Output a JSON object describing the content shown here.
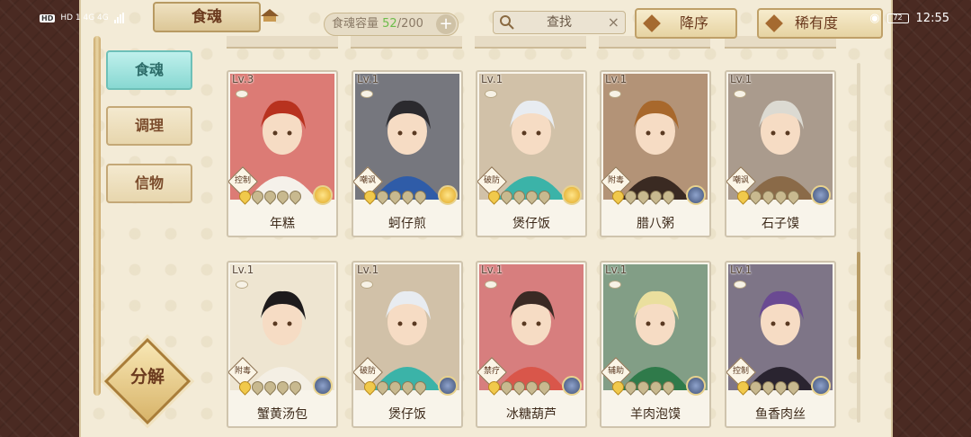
{
  "status_bar": {
    "left_text": "HD 1 4G 4G",
    "time": "12:55",
    "battery": "72"
  },
  "topbar": {
    "title": "食魂",
    "capacity": {
      "label": "食魂容量",
      "current": "52",
      "max": "/200"
    },
    "search": {
      "placeholder": "查找",
      "clear": "×"
    },
    "sort_order": "降序",
    "sort_by": "稀有度"
  },
  "sidebar": {
    "items": [
      {
        "label": "食魂",
        "active": true
      },
      {
        "label": "调理",
        "active": false
      },
      {
        "label": "信物",
        "active": false
      }
    ],
    "decompose": "分解"
  },
  "cards": [
    {
      "level": "Lv.3",
      "name": "年糕",
      "role": "控制",
      "stars": 1,
      "badge": "gold",
      "bg": "#c9352b",
      "hair": "#b8321f",
      "cloth": "#f5f1ea"
    },
    {
      "level": "Lv.1",
      "name": "蚵仔煎",
      "role": "嘲讽",
      "stars": 1,
      "badge": "gold",
      "bg": "#2d2f3a",
      "hair": "#2b2a2e",
      "cloth": "#2f5ca8"
    },
    {
      "level": "Lv.1",
      "name": "煲仔饭",
      "role": "破防",
      "stars": 1,
      "badge": "gold",
      "bg": "#b8a07a",
      "hair": "#e8ecf1",
      "cloth": "#3bb3a8"
    },
    {
      "level": "Lv.1",
      "name": "腊八粥",
      "role": "附毒",
      "stars": 1,
      "badge": "blue",
      "bg": "#8a5a2f",
      "hair": "#a8682c",
      "cloth": "#3a2a22"
    },
    {
      "level": "Lv.1",
      "name": "石子馍",
      "role": "嘲讽",
      "stars": 1,
      "badge": "blue",
      "bg": "#7d6650",
      "hair": "#dcdad2",
      "cloth": "#8a6a48"
    },
    {
      "level": "Lv.1",
      "name": "蟹黄汤包",
      "role": "附毒",
      "stars": 1,
      "badge": "blue",
      "bg": "#e5d8b8",
      "hair": "#1e1b1c",
      "cloth": "#f4efe4"
    },
    {
      "level": "Lv.1",
      "name": "煲仔饭",
      "role": "破防",
      "stars": 1,
      "badge": "blue",
      "bg": "#b8a07a",
      "hair": "#e8ecf1",
      "cloth": "#3bb3a8"
    },
    {
      "level": "Lv.1",
      "name": "冰糖葫芦",
      "role": "禁疗",
      "stars": 1,
      "badge": "blue",
      "bg": "#c23a3a",
      "hair": "#3a2a24",
      "cloth": "#d9564a"
    },
    {
      "level": "Lv.1",
      "name": "羊肉泡馍",
      "role": "辅助",
      "stars": 1,
      "badge": "blue",
      "bg": "#3f6a45",
      "hair": "#eadf9e",
      "cloth": "#2f7a4a"
    },
    {
      "level": "Lv.1",
      "name": "鱼香肉丝",
      "role": "控制",
      "stars": 1,
      "badge": "blue",
      "bg": "#3a2c48",
      "hair": "#6a4a92",
      "cloth": "#2a2430"
    }
  ]
}
